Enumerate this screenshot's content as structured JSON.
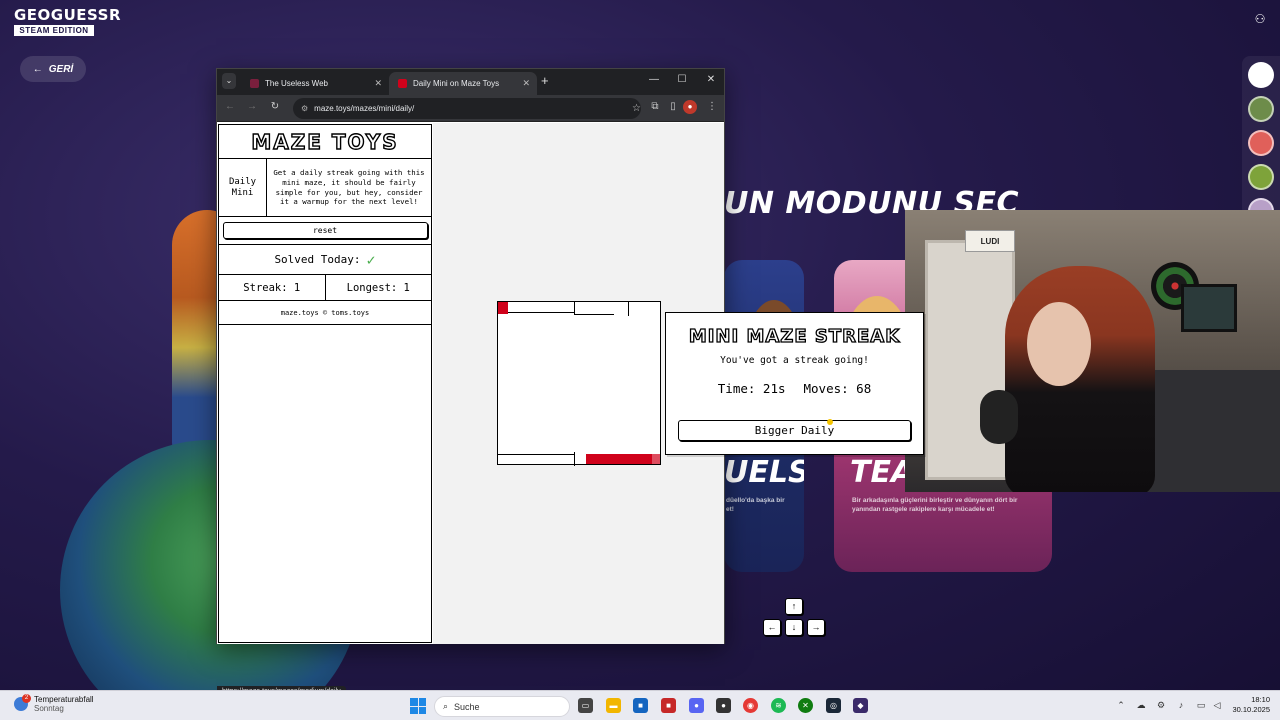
{
  "game": {
    "logo_line1": "GEOGUESSR",
    "logo_line2": "STEAM EDITION",
    "back_label": "GERİ",
    "mode_title": "UN MODUNU SEÇ",
    "cards": [
      {
        "big": "UELS",
        "desc": "düello'da başka bir\net!"
      },
      {
        "big": "TEA",
        "desc": "Bir arkadaşınla güçlerini birleştir ve dünyanın dört bir\nyanından rastgele rakiplere karşı mücadele et!"
      }
    ],
    "webcam_board_text": "LUDI"
  },
  "browser": {
    "tabs": [
      {
        "label": "The Useless Web",
        "favicon_color": "#7a1f3d",
        "active": false
      },
      {
        "label": "Daily Mini on Maze Toys",
        "favicon_color": "#d0021b",
        "active": true
      }
    ],
    "url": "maze.toys/mazes/mini/daily/",
    "status_link": "https://maze.toys/mazes/medium/daily"
  },
  "maze_page": {
    "site_title": "MAZE TOYS",
    "mode_label": "Daily Mini",
    "mode_description": "Get a daily streak going with this mini maze, it should be fairly simple for you, but hey, consider it a warmup for the next level!",
    "reset_label": "reset",
    "solved_today_label": "Solved Today:",
    "solved_today_checked": true,
    "streak_label": "Streak: 1",
    "longest_label": "Longest: 1",
    "footer": "maze.toys © toms.toys"
  },
  "modal": {
    "title": "MINI MAZE STREAK",
    "subtitle": "You've got a streak going!",
    "time": "Time: 21s",
    "moves": "Moves: 68",
    "button_label": "Bigger Daily"
  },
  "keys": {
    "up": "↑",
    "down": "↓",
    "left": "←",
    "right": "→"
  },
  "taskbar": {
    "weather_title": "Temperaturabfall",
    "weather_sub": "Sonntag",
    "weather_badge": "2",
    "search_placeholder": "Suche",
    "time": "18:10",
    "date": "30.10.2025"
  }
}
